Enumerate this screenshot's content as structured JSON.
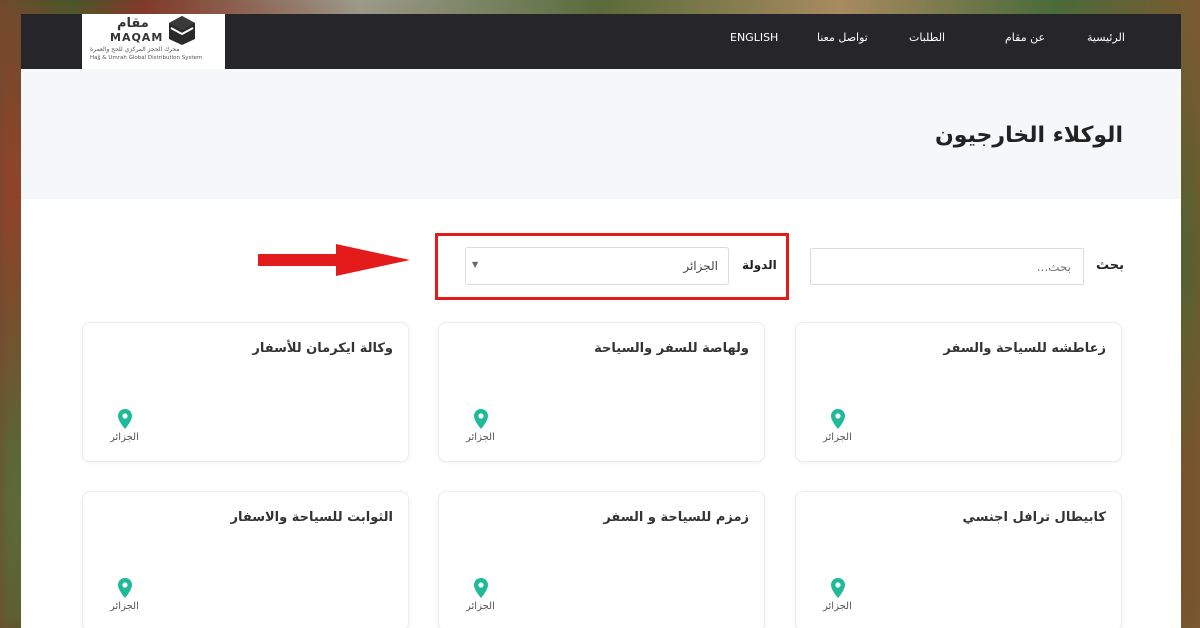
{
  "nav": {
    "items": [
      "الرئيسية",
      "عن مقام",
      "الطلبات",
      "تواصل معنا",
      "ENGLISH"
    ]
  },
  "logo": {
    "arabic": "مقام",
    "english": "MAQAM",
    "subtitle_ar": "محرك الحجز المركزي للحج والعمرة",
    "subtitle_en": "Hajj & Umrah Global Distribution System"
  },
  "page": {
    "title": "الوكلاء الخارجيون"
  },
  "filters": {
    "search_label": "بحث",
    "search_placeholder": "بحث...",
    "country_label": "الدولة",
    "country_value": "الجزائر"
  },
  "agents": [
    {
      "name": "زعاطشه للسياحة والسفر",
      "country": "الجزائر"
    },
    {
      "name": "ولهاصة للسفر والسياحة",
      "country": "الجزائر"
    },
    {
      "name": "وكالة ايكرمان للأسفار",
      "country": "الجزائر"
    },
    {
      "name": "كابيطال ترافل اجنسي",
      "country": "الجزائر"
    },
    {
      "name": "زمزم للسياحة و السفر",
      "country": "الجزائر"
    },
    {
      "name": "الثوابت للسياحة والاسفار",
      "country": "الجزائر"
    }
  ],
  "colors": {
    "navbar": "#26262a",
    "highlight": "#e31b1b",
    "pin": "#1fba9a"
  }
}
